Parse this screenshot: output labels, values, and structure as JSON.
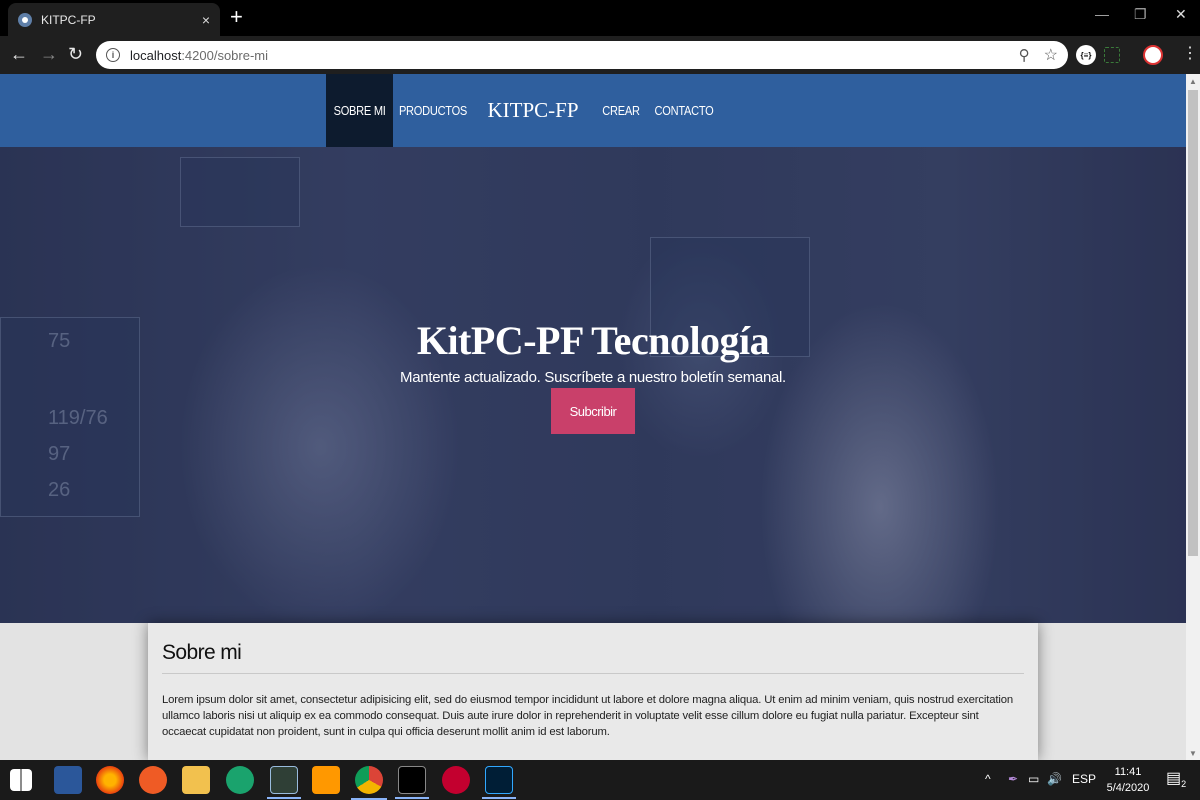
{
  "browser": {
    "tab_title": "KITPC-FP",
    "tab_close": "×",
    "new_tab": "+",
    "back": "←",
    "forward": "→",
    "reload": "↻",
    "url_host": "localhost",
    "url_path": ":4200/sobre-mi",
    "info_icon_text": "i",
    "zoom_icon": "⚲",
    "star_icon": "☆",
    "ext_label": "{≡}",
    "menu": "⋮",
    "win_min": "—",
    "win_restore": "❐",
    "win_close": "✕"
  },
  "site": {
    "nav": {
      "sobre_mi": "SOBRE MI",
      "productos": "PRODUCTOS",
      "brand": "KITPC-FP",
      "crear": "CREAR",
      "contacto": "CONTACTO"
    },
    "hero": {
      "title": "KitPC-PF Tecnología",
      "subtitle": "Mantente actualizado. Suscríbete a nuestro boletín semanal.",
      "button": "Subcribir",
      "readouts": [
        "75",
        "119/76",
        "97",
        "26"
      ]
    },
    "about": {
      "heading": "Sobre mi",
      "body": "Lorem ipsum dolor sit amet, consectetur adipisicing elit, sed do eiusmod tempor incididunt ut labore et dolore magna aliqua. Ut enim ad minim veniam, quis nostrud exercitation ullamco laboris nisi ut aliquip ex ea commodo consequat. Duis aute irure dolor in reprehenderit in voluptate velit esse cillum dolore eu fugiat nulla pariatur. Excepteur sint occaecat cupidatat non proident, sunt in culpa qui officia deserunt mollit anim id est laborum."
    }
  },
  "taskbar": {
    "apps": [
      "start-icon",
      "word-icon",
      "firefox-icon",
      "postman-icon",
      "file-explorer-icon",
      "gitkraken-icon",
      "terminal-icon",
      "sublime-icon",
      "chrome-icon",
      "cmd-icon",
      "angular-icon",
      "photoshop-icon"
    ],
    "tray_up": "^",
    "volume": "🔊",
    "language": "ESP",
    "time": "11:41",
    "date": "5/4/2020",
    "notifications": "2"
  },
  "colors": {
    "nav_bg": "#2f5f9e",
    "nav_active": "#0d1b2e",
    "button": "#c9406a"
  }
}
